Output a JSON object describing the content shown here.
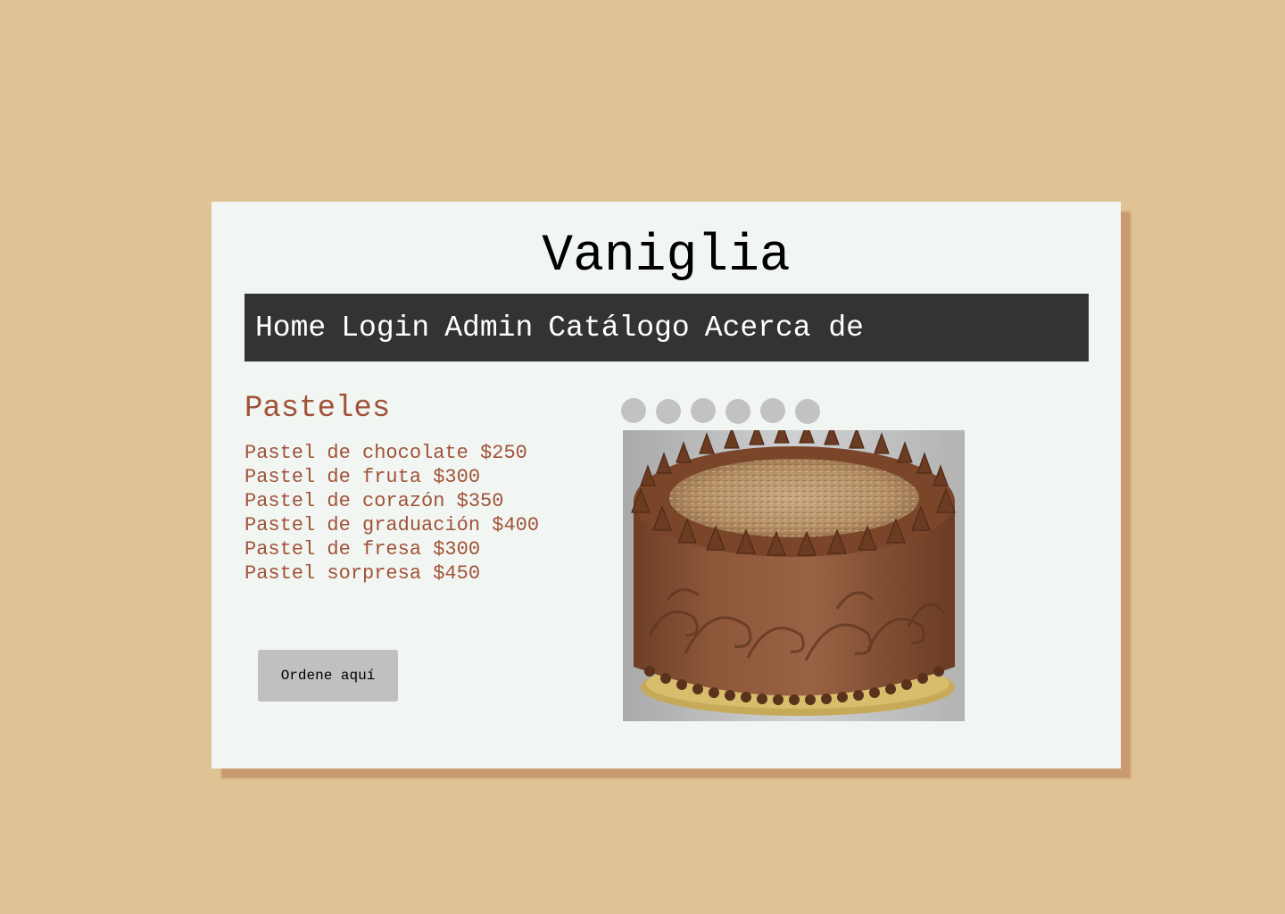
{
  "header": {
    "title": "Vaniglia"
  },
  "nav": {
    "items": [
      {
        "label": "Home"
      },
      {
        "label": "Login"
      },
      {
        "label": "Admin"
      },
      {
        "label": "Catálogo"
      },
      {
        "label": "Acerca de"
      }
    ]
  },
  "main": {
    "section_title": "Pasteles",
    "products": [
      {
        "text": "Pastel de chocolate $250"
      },
      {
        "text": "Pastel de fruta $300"
      },
      {
        "text": "Pastel de corazón $350"
      },
      {
        "text": "Pastel de graduación $400"
      },
      {
        "text": "Pastel de fresa $300"
      },
      {
        "text": "Pastel sorpresa $450"
      }
    ],
    "order_button": "Ordene aquí",
    "slideshow": {
      "dot_count": 6,
      "image": "chocolate-cake-photo"
    }
  },
  "colors": {
    "background": "#dfc394",
    "card": "#f2f6f2",
    "card_shadow": "#c99a6f",
    "navbar": "#333333",
    "accent_text": "#a0523a",
    "button": "#c0c0c0",
    "dot": "#c2c2c2"
  }
}
